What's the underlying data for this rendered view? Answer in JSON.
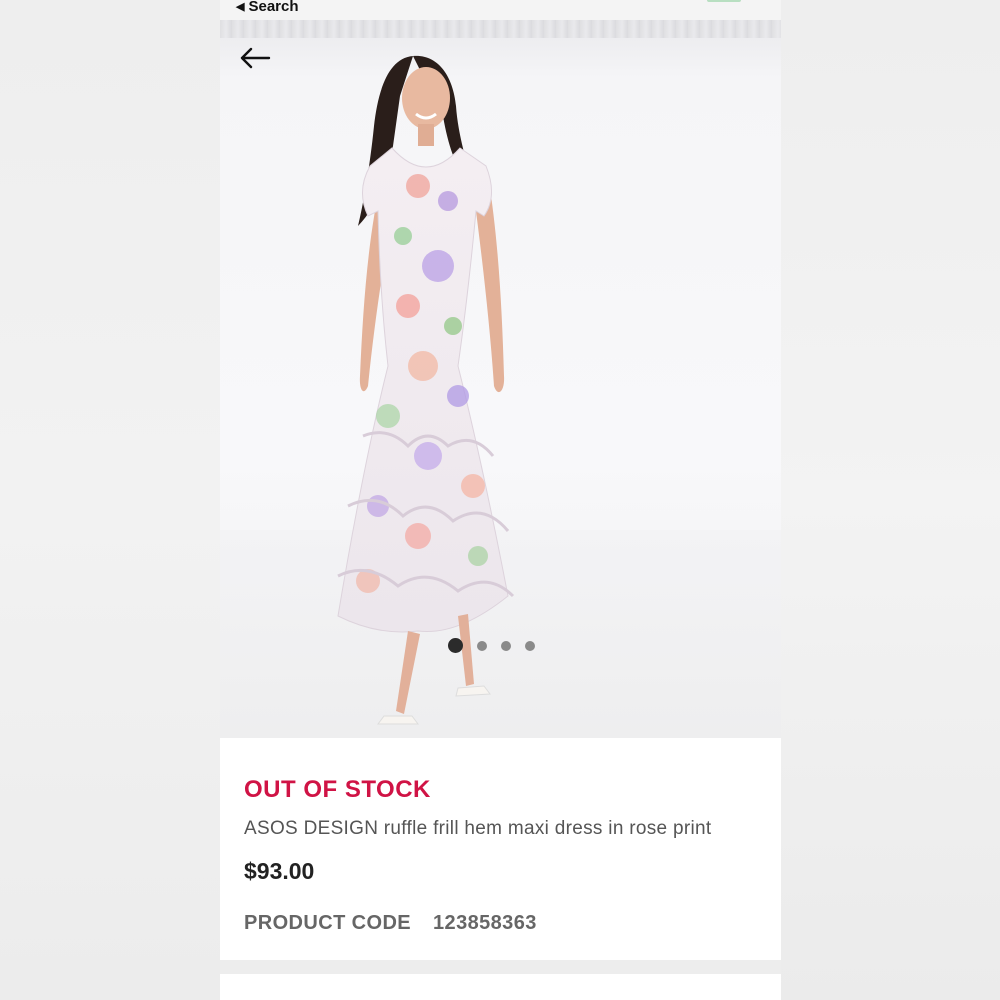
{
  "status_bar": {
    "back_label": "Search"
  },
  "colors": {
    "stock_accent": "#d01345",
    "page_bg": "#ededed"
  },
  "gallery": {
    "image_count": 4,
    "active_index": 0
  },
  "product": {
    "stock_status": "OUT OF STOCK",
    "name": "ASOS DESIGN ruffle frill hem maxi dress in rose print",
    "price": "$93.00",
    "code_label": "PRODUCT CODE",
    "code_value": "123858363"
  }
}
